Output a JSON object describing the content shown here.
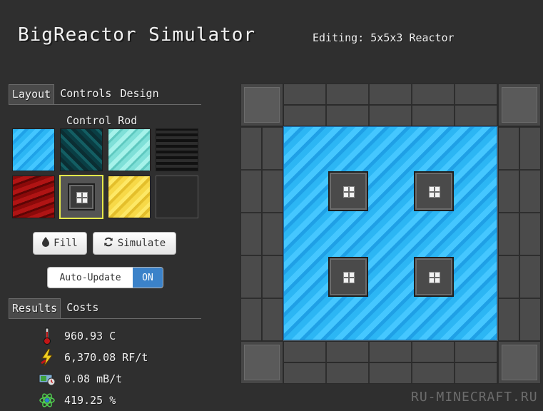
{
  "header": {
    "title": "BigReactor Simulator",
    "editing": "Editing: 5x5x3 Reactor"
  },
  "tabs_top": [
    {
      "label": "Layout",
      "active": true
    },
    {
      "label": "Controls",
      "active": false
    },
    {
      "label": "Design",
      "active": false
    }
  ],
  "palette": {
    "title": "Control Rod",
    "selected": "control-rod",
    "items": [
      {
        "name": "water-block-icon"
      },
      {
        "name": "cyan-block-icon"
      },
      {
        "name": "ice-block-icon"
      },
      {
        "name": "black-block-icon"
      },
      {
        "name": "redstone-block-icon"
      },
      {
        "name": "control-rod-icon"
      },
      {
        "name": "gold-block-icon"
      },
      {
        "name": "empty-block-icon"
      }
    ]
  },
  "buttons": {
    "fill": "Fill",
    "simulate": "Simulate"
  },
  "auto_update": {
    "label": "Auto-Update",
    "state": "ON"
  },
  "tabs_bottom": [
    {
      "label": "Results",
      "active": true
    },
    {
      "label": "Costs",
      "active": false
    }
  ],
  "results": [
    {
      "icon": "thermometer-icon",
      "value": "960.93 C"
    },
    {
      "icon": "lightning-icon",
      "value": "6,370.08 RF/t"
    },
    {
      "icon": "fuel-icon",
      "value": "0.08 mB/t"
    },
    {
      "icon": "atom-icon",
      "value": "419.25 %"
    }
  ],
  "watermark": "RU-MINECRAFT.RU",
  "colors": {
    "background": "#2f2f2f",
    "water": "#2cb6f4",
    "toggle_on": "#3b82c9",
    "selection": "#e5e84a"
  }
}
